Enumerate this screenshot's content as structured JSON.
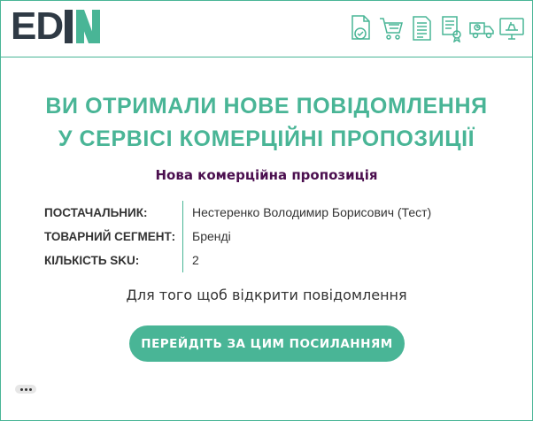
{
  "logo": {
    "text_dark": "ED",
    "text_accent": "N"
  },
  "header_icons": [
    "document-check-icon",
    "shopping-cart-icon",
    "invoice-document-icon",
    "certificate-document-icon",
    "delivery-truck-icon",
    "monitor-shipping-icon"
  ],
  "heading": {
    "line1": "ВИ ОТРИМАЛИ НОВЕ ПОВІДОМЛЕННЯ",
    "line2": "У СЕРВІСІ КОМЕРЦІЙНІ ПРОПОЗИЦІЇ"
  },
  "subheading": "Нова комерційна пропозиція",
  "details": [
    {
      "label": "ПОСТАЧАЛЬНИК:",
      "value": "Нестеренко Володимир Борисович (Тест)"
    },
    {
      "label": "ТОВАРНИЙ СЕГМЕНТ:",
      "value": "Бренді"
    },
    {
      "label": "КІЛЬКІСТЬ SKU:",
      "value": "2"
    }
  ],
  "open_text": "Для того щоб відкрити повідомлення",
  "cta_label": "ПЕРЕЙДІТЬ ЗА ЦИМ ПОСИЛАННЯМ",
  "colors": {
    "accent": "#49b596",
    "dark": "#2f3a45",
    "purple": "#4b0f4f"
  }
}
